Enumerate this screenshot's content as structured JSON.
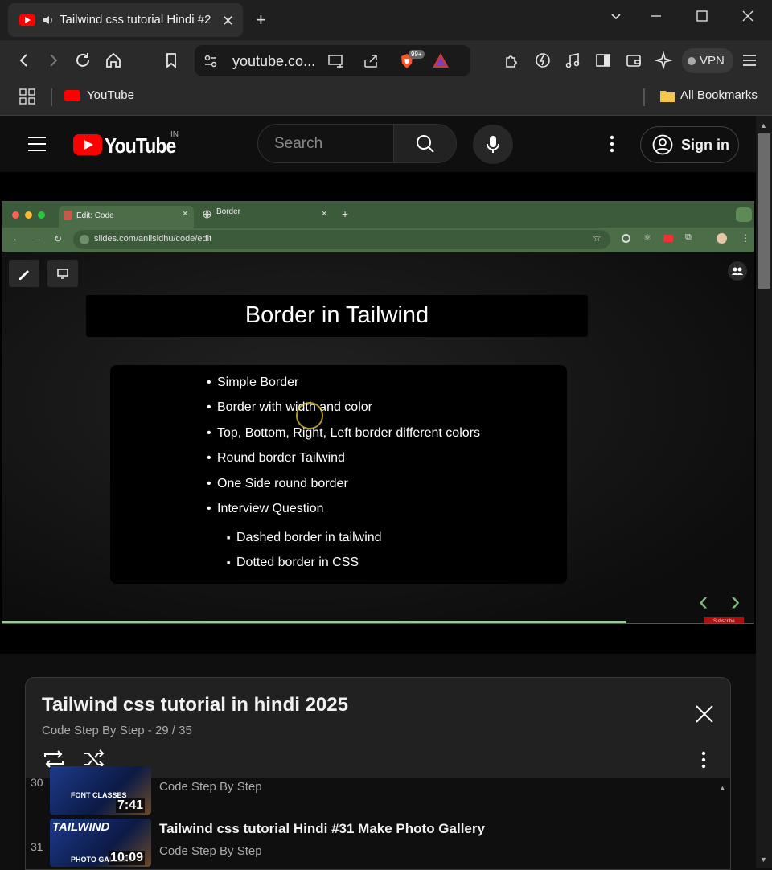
{
  "browser": {
    "tab_title": "Tailwind css tutorial Hindi #2",
    "url": "youtube.co...",
    "brave_badge": "99+",
    "vpn_label": "VPN",
    "bookmarks": [
      {
        "label": "YouTube"
      }
    ],
    "all_bookmarks_label": "All Bookmarks"
  },
  "youtube": {
    "logo": "YouTube",
    "country": "IN",
    "search_placeholder": "Search",
    "sign_in": "Sign in"
  },
  "video": {
    "inner_browser": {
      "tab1": "Edit: Code",
      "tab2": "Border",
      "url": "slides.com/anilsidhu/code/edit"
    },
    "slide": {
      "title": "Border in Tailwind",
      "bullets": [
        "Simple Border",
        "Border with width and color",
        "Top, Bottom, Right, Left border different colors",
        "Round border Tailwind",
        "One Side round border",
        "Interview Question"
      ],
      "sub_bullets": [
        "Dashed border in tailwind",
        "Dotted border in CSS"
      ]
    },
    "subscribe_badge": "Subscribe",
    "progress": 0.83
  },
  "playlist": {
    "title": "Tailwind css tutorial in hindi 2025",
    "channel": "Code Step By Step",
    "position": "29 / 35",
    "items": [
      {
        "index": "30",
        "title": "",
        "channel": "Code Step By Step",
        "duration": "7:41",
        "thumb_text": "FONT CLASSES"
      },
      {
        "index": "31",
        "title": "Tailwind css tutorial Hindi #31 Make Photo Gallery",
        "channel": "Code Step By Step",
        "duration": "10:09",
        "thumb_text": "PHOTO GALLERY",
        "thumb_brand": "TAILWIND"
      }
    ]
  },
  "colors": {
    "yt_red": "#ff0000",
    "inner_chrome_green": "#4b6d47",
    "bg": "#0f0f0f"
  }
}
